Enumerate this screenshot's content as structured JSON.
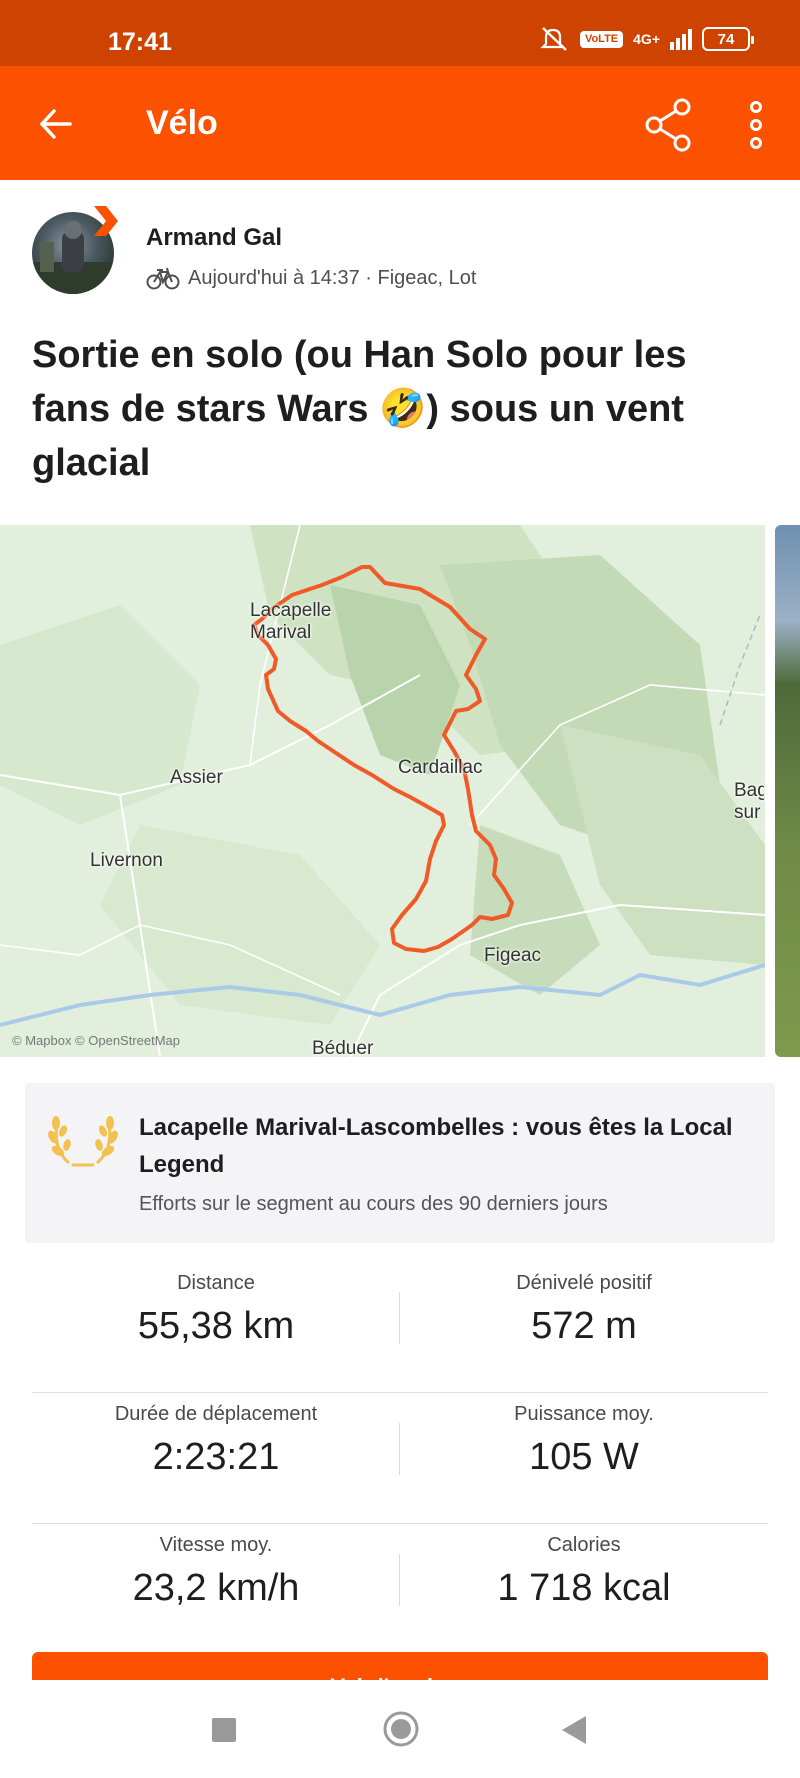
{
  "status_bar": {
    "time": "17:41",
    "network_badge": "VoLTE",
    "network_type": "4G+",
    "battery": "74",
    "icons": [
      "mute-icon",
      "volte-icon",
      "signal-icon",
      "battery-icon"
    ]
  },
  "app_bar": {
    "title": "Vélo",
    "icons": [
      "back-arrow-icon",
      "share-icon",
      "more-vert-icon"
    ]
  },
  "athlete": {
    "name": "Armand Gal",
    "activity_meta": "Aujourd'hui à 14:37 · Figeac, Lot",
    "sport_icon": "bicycle-icon"
  },
  "activity": {
    "title": "Sortie en solo (ou Han Solo pour les fans de stars Wars 🤣) sous un vent glacial"
  },
  "map": {
    "labels": {
      "lacapelle": "Lacapelle Marival",
      "assier": "Assier",
      "cardaillac": "Cardaillac",
      "livernon": "Livernon",
      "figeac": "Figeac",
      "beduer": "Béduer",
      "bagnac": "Bag sur"
    },
    "attribution": "© Mapbox © OpenStreetMap",
    "route_color": "#f05a28"
  },
  "local_legend": {
    "title": "Lacapelle Marival-Lascombelles : vous êtes la Local Legend",
    "subtitle": "Efforts sur le segment au cours des 90 derniers jours",
    "icon": "laurel-wreath-icon",
    "accent": "#f2c14e"
  },
  "stats": {
    "distance": {
      "label": "Distance",
      "value": "55,38 km"
    },
    "elevation": {
      "label": "Dénivelé positif",
      "value": "572 m"
    },
    "moving_time": {
      "label": "Durée de déplacement",
      "value": "2:23:21"
    },
    "avg_power": {
      "label": "Puissance moy.",
      "value": "105 W"
    },
    "avg_speed": {
      "label": "Vitesse moy.",
      "value": "23,2 km/h"
    },
    "calories": {
      "label": "Calories",
      "value": "1 718 kcal"
    }
  },
  "cta": {
    "label": "Voir l'analyse"
  },
  "colors": {
    "brand": "#fc5200",
    "status_bar": "#cf4300"
  }
}
